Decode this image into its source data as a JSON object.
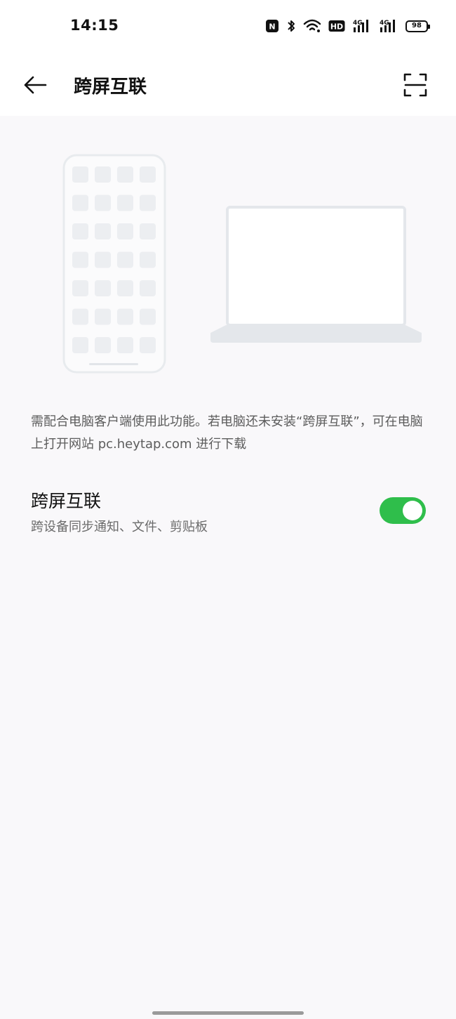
{
  "status_bar": {
    "time": "14:15",
    "icons": [
      "nfc-icon",
      "bluetooth-icon",
      "wifi-icon",
      "hd-icon",
      "signal-4g-icon",
      "signal-4g-icon"
    ],
    "nfc_label": "N",
    "hd_label": "HD",
    "network_label_1": "4G",
    "network_label_2": "4G",
    "battery_level": "98"
  },
  "app_bar": {
    "title": "跨屏互联",
    "back_icon": "arrow-left-icon",
    "scan_icon": "scan-icon"
  },
  "main": {
    "description": "需配合电脑客户端使用此功能。若电脑还未安装“跨屏互联”，可在电脑上打开网站 pc.heytap.com 进行下载",
    "setting": {
      "title": "跨屏互联",
      "subtitle": "跨设备同步通知、文件、剪贴板",
      "enabled": true
    }
  },
  "colors": {
    "toggle_on": "#2fbe4b",
    "background": "#f9f8fa",
    "illustration_stroke": "#e8ebee",
    "illustration_fill": "#eceef1"
  }
}
